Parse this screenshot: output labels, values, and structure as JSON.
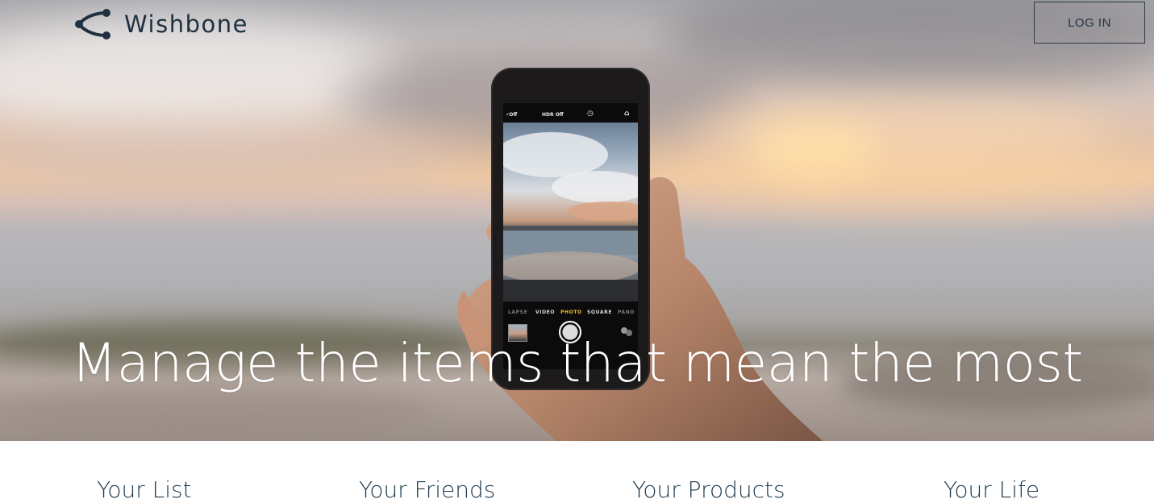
{
  "header": {
    "brand_name": "Wishbone",
    "login_label": "LOG IN"
  },
  "hero": {
    "headline": "Manage the items that mean the most",
    "phone_camera": {
      "flash": "⚡Off",
      "hdr": "HDR Off",
      "modes": [
        "LAPSE",
        "VIDEO",
        "PHOTO",
        "SQUARE",
        "PANO"
      ],
      "active_mode": "PHOTO"
    }
  },
  "features": [
    {
      "label": "Your List"
    },
    {
      "label": "Your Friends"
    },
    {
      "label": "Your Products"
    },
    {
      "label": "Your Life"
    }
  ],
  "colors": {
    "brand_dark": "#1f3140",
    "feature_text": "#1e3a4e",
    "headline_text": "#ffffff",
    "active_mode": "#f2c028"
  }
}
